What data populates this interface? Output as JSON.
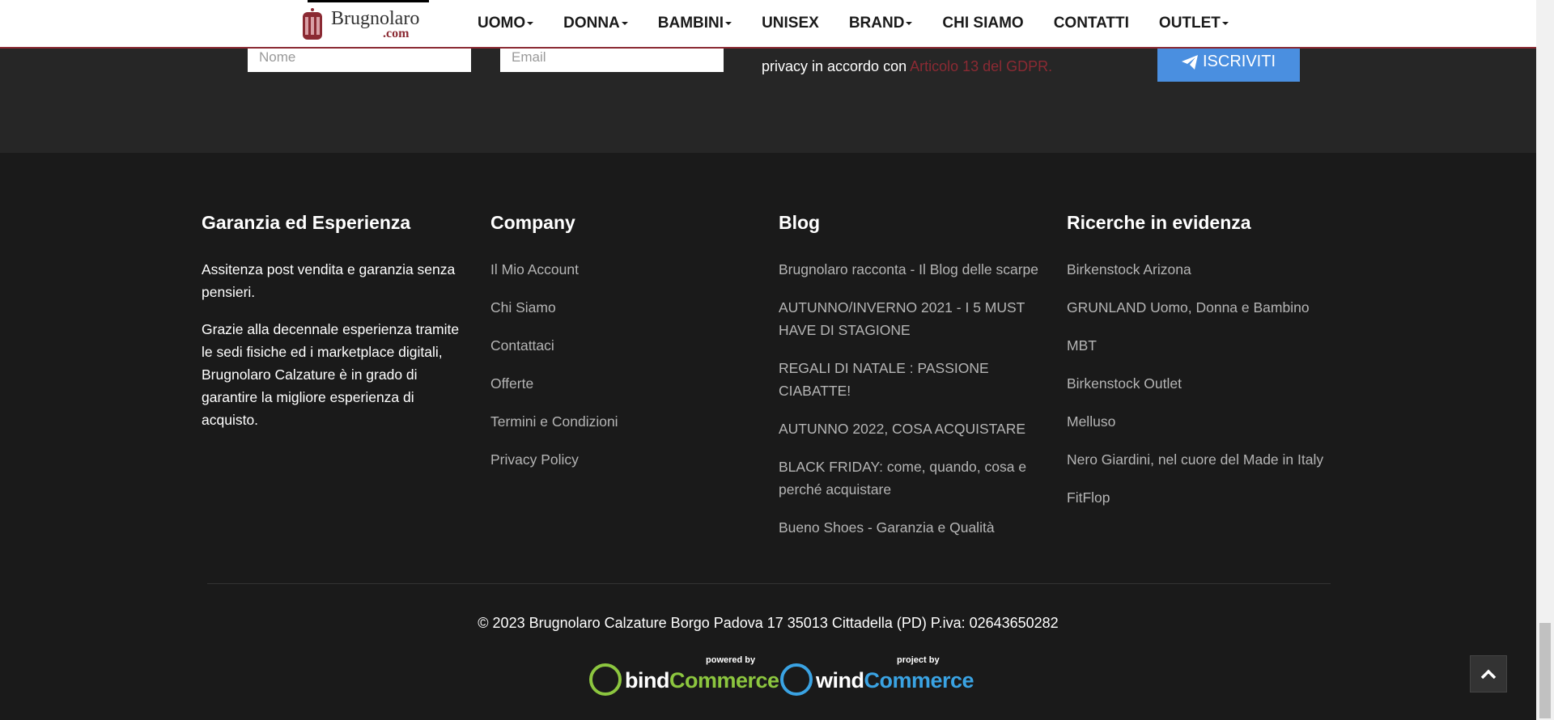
{
  "brand": {
    "name": "Brugnolaro",
    "domain": ".com",
    "accent_color": "#8b2a33"
  },
  "nav": {
    "items": [
      {
        "label": "UOMO",
        "dropdown": true
      },
      {
        "label": "DONNA",
        "dropdown": true
      },
      {
        "label": "BAMBINI",
        "dropdown": true
      },
      {
        "label": "UNISEX",
        "dropdown": false
      },
      {
        "label": "BRAND",
        "dropdown": true
      },
      {
        "label": "CHI SIAMO",
        "dropdown": false
      },
      {
        "label": "CONTATTI",
        "dropdown": false
      },
      {
        "label": "OUTLET",
        "dropdown": true
      }
    ]
  },
  "newsletter": {
    "name_placeholder": "Nome",
    "email_placeholder": "Email",
    "privacy_text": "privacy in accordo con",
    "privacy_link": "Articolo 13 del GDPR.",
    "subscribe_label": "ISCRIVITI",
    "button_color": "#4a8fe0"
  },
  "footer": {
    "col1": {
      "title": "Garanzia ed Esperienza",
      "p1": "Assitenza post vendita e garanzia senza pensieri.",
      "p2": "Grazie alla decennale esperienza tramite le sedi fisiche ed i marketplace digitali, Brugnolaro Calzature è in grado di garantire la migliore esperienza di acquisto."
    },
    "col2": {
      "title": "Company",
      "links": [
        "Il Mio Account",
        "Chi Siamo",
        "Contattaci",
        "Offerte",
        "Termini e Condizioni",
        "Privacy Policy"
      ]
    },
    "col3": {
      "title": "Blog",
      "links": [
        "Brugnolaro racconta - Il Blog delle scarpe",
        "AUTUNNO/INVERNO 2021 - I 5 MUST HAVE DI STAGIONE",
        "REGALI DI NATALE : PASSIONE CIABATTE!",
        "AUTUNNO 2022, COSA ACQUISTARE",
        "BLACK FRIDAY: come, quando, cosa e perché acquistare",
        "Bueno Shoes - Garanzia e Qualità"
      ]
    },
    "col4": {
      "title": "Ricerche in evidenza",
      "links": [
        "Birkenstock Arizona",
        "GRUNLAND Uomo, Donna e Bambino",
        "MBT",
        "Birkenstock Outlet",
        "Melluso",
        "Nero Giardini, nel cuore del Made in Italy",
        "FitFlop"
      ]
    },
    "copyright": "© 2023 Brugnolaro Calzature Borgo Padova 17 35013 Cittadella (PD) P.iva: 02643650282",
    "badges": {
      "bind_small": "powered by",
      "bind_a": "bind",
      "bind_b": "Commerce",
      "bind_color": "#8cc63f",
      "wind_small": "project by",
      "wind_a": "wind",
      "wind_b": "Commerce",
      "wind_color": "#3aa3e3"
    }
  }
}
